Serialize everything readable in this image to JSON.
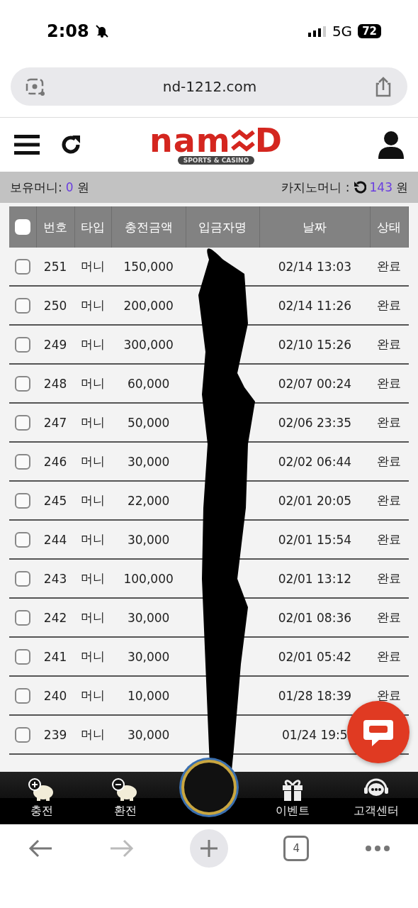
{
  "status_bar": {
    "time": "2:08",
    "muted": true,
    "network": "5G",
    "battery": "72"
  },
  "browser": {
    "url": "nd-1212.com",
    "tab_count": "4",
    "forward_disabled": true
  },
  "site_header": {
    "logo": {
      "left": "nam",
      "right": "D",
      "tagline": "SPORTS & CASINO"
    }
  },
  "balance": {
    "wallet_label": "보유머니:",
    "wallet_amount": "0",
    "wallet_unit": "원",
    "casino_label": "카지노머니 :",
    "casino_amount": "143",
    "casino_unit": "원"
  },
  "table": {
    "select_all_checked": false,
    "columns": [
      "번호",
      "타입",
      "충전금액",
      "입금자명",
      "날짜",
      "상태"
    ],
    "rows": [
      {
        "checked": false,
        "no": "251",
        "type": "머니",
        "amount": "150,000",
        "date": "02/14 13:03",
        "status": "완료"
      },
      {
        "checked": false,
        "no": "250",
        "type": "머니",
        "amount": "200,000",
        "date": "02/14 11:26",
        "status": "완료"
      },
      {
        "checked": false,
        "no": "249",
        "type": "머니",
        "amount": "300,000",
        "date": "02/10 15:26",
        "status": "완료"
      },
      {
        "checked": false,
        "no": "248",
        "type": "머니",
        "amount": "60,000",
        "date": "02/07 00:24",
        "status": "완료"
      },
      {
        "checked": false,
        "no": "247",
        "type": "머니",
        "amount": "50,000",
        "date": "02/06 23:35",
        "status": "완료"
      },
      {
        "checked": false,
        "no": "246",
        "type": "머니",
        "amount": "30,000",
        "date": "02/02 06:44",
        "status": "완료"
      },
      {
        "checked": false,
        "no": "245",
        "type": "머니",
        "amount": "22,000",
        "date": "02/01 20:05",
        "status": "완료"
      },
      {
        "checked": false,
        "no": "244",
        "type": "머니",
        "amount": "30,000",
        "date": "02/01 15:54",
        "status": "완료"
      },
      {
        "checked": false,
        "no": "243",
        "type": "머니",
        "amount": "100,000",
        "date": "02/01 13:12",
        "status": "완료"
      },
      {
        "checked": false,
        "no": "242",
        "type": "머니",
        "amount": "30,000",
        "date": "02/01 08:36",
        "status": "완료"
      },
      {
        "checked": false,
        "no": "241",
        "type": "머니",
        "amount": "30,000",
        "date": "02/01 05:42",
        "status": "완료"
      },
      {
        "checked": false,
        "no": "240",
        "type": "머니",
        "amount": "10,000",
        "date": "01/28 18:39",
        "status": "완료"
      },
      {
        "checked": false,
        "no": "239",
        "type": "머니",
        "amount": "30,000",
        "date": "01/24 19:5"
      }
    ]
  },
  "bottom_nav": [
    {
      "kind": "deposit",
      "label": "충전"
    },
    {
      "kind": "withdraw",
      "label": "환전"
    },
    {
      "kind": "center"
    },
    {
      "kind": "event",
      "label": "이벤트"
    },
    {
      "kind": "support",
      "label": "고객센터"
    }
  ]
}
